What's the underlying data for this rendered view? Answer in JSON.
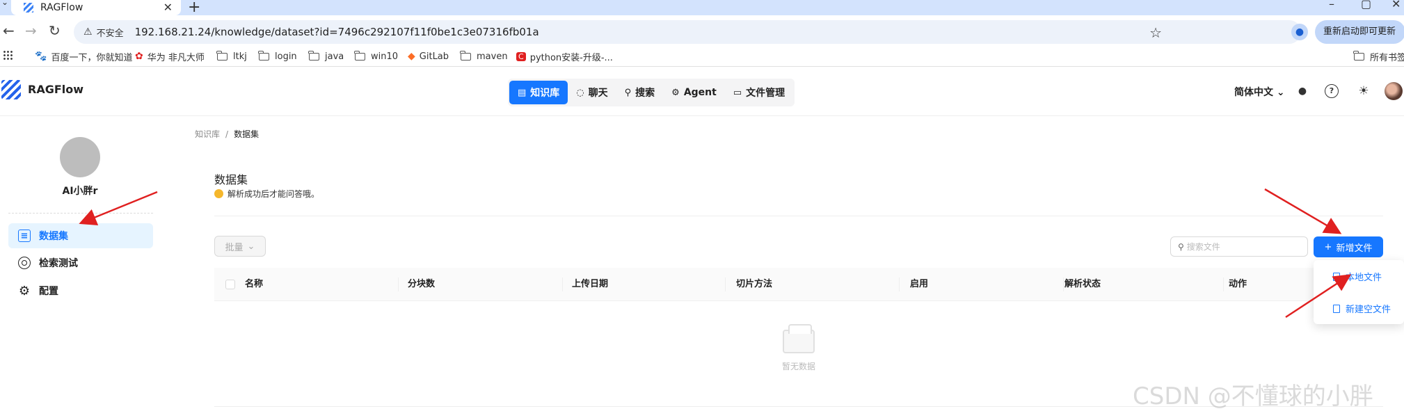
{
  "browser": {
    "tab_title": "RAGFlow",
    "insecure_label": "不安全",
    "url": "192.168.21.24/knowledge/dataset?id=7496c292107f11f0be1c3e07316fb01a",
    "update_label": "重新启动即可更新",
    "bookmarks": [
      {
        "icon": "baidu-icon",
        "label": "百度一下，你就知道"
      },
      {
        "icon": "huawei-icon",
        "label": "华为 非凡大师"
      },
      {
        "icon": "folder-icon",
        "label": "ltkj"
      },
      {
        "icon": "folder-icon",
        "label": "login"
      },
      {
        "icon": "folder-icon",
        "label": "java"
      },
      {
        "icon": "folder-icon",
        "label": "win10"
      },
      {
        "icon": "gitlab-icon",
        "label": "GitLab"
      },
      {
        "icon": "folder-icon",
        "label": "maven"
      },
      {
        "icon": "csdn-icon",
        "label": "python安装-升级-..."
      }
    ],
    "all_bookmarks": "所有书签"
  },
  "header": {
    "logo_text": "RAGFlow",
    "nav": [
      {
        "label": "知识库",
        "icon": "database-icon",
        "active": true
      },
      {
        "label": "聊天",
        "icon": "chat-icon",
        "active": false
      },
      {
        "label": "搜索",
        "icon": "search-icon",
        "active": false
      },
      {
        "label": "Agent",
        "icon": "agent-icon",
        "active": false
      },
      {
        "label": "文件管理",
        "icon": "folder-icon",
        "active": false
      }
    ],
    "language": "简体中文"
  },
  "sidebar": {
    "user_name": "AI小胖r",
    "items": [
      {
        "label": "数据集",
        "icon": "document-icon",
        "active": true
      },
      {
        "label": "检索测试",
        "icon": "target-icon",
        "active": false
      },
      {
        "label": "配置",
        "icon": "gear-icon",
        "active": false
      }
    ]
  },
  "main": {
    "breadcrumb": {
      "parent": "知识库",
      "separator": "/",
      "current": "数据集"
    },
    "title": "数据集",
    "tip": "解析成功后才能问答哦。",
    "batch_label": "批量",
    "search_placeholder": "搜索文件",
    "new_file_label": "新增文件",
    "columns": [
      "名称",
      "分块数",
      "上传日期",
      "切片方法",
      "启用",
      "解析状态",
      "动作"
    ],
    "empty_text": "暂无数据",
    "dropdown": [
      "本地文件",
      "新建空文件"
    ]
  },
  "watermark": "CSDN @不懂球的小胖",
  "colors": {
    "accent": "#1677ff",
    "arrow": "#e02020",
    "sidebar_active_bg": "#e6f4ff"
  }
}
